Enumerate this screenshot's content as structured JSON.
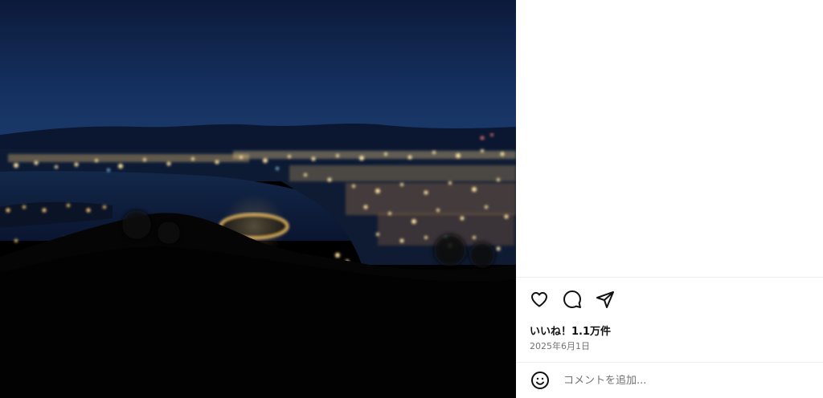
{
  "media": {
    "alt": "night city view"
  },
  "actions": {
    "like_icon": "heart-icon",
    "comment_icon": "comment-bubble-icon",
    "share_icon": "paper-plane-icon"
  },
  "post": {
    "likes_text": "いいね！1.1万件",
    "date_text": "2025年6月1日"
  },
  "comment": {
    "emoji_icon": "smiley-icon",
    "placeholder": "コメントを追加..."
  }
}
